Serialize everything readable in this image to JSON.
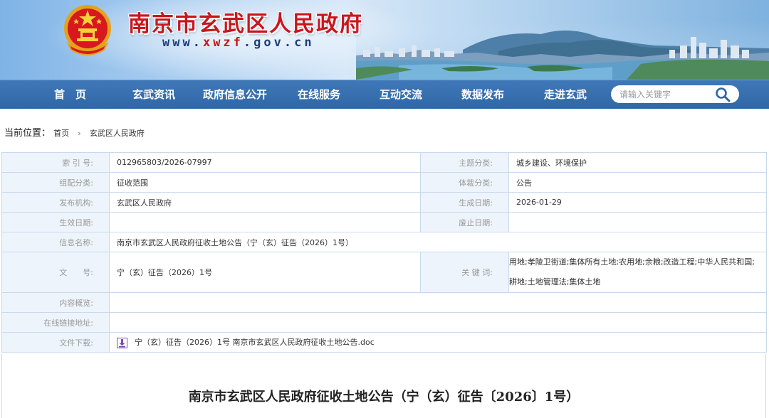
{
  "header": {
    "site_title": "南京市玄武区人民政府",
    "site_url_prefix": "www.",
    "site_url_highlight": "xwzf",
    "site_url_suffix": ".gov.cn",
    "emblem_icon": "national-emblem-icon",
    "brand_red": "#c8171e",
    "brand_blue": "#2f66a6"
  },
  "nav": {
    "items": [
      {
        "label": "首　页"
      },
      {
        "label": "玄武资讯"
      },
      {
        "label": "政府信息公开"
      },
      {
        "label": "在线服务"
      },
      {
        "label": "互动交流"
      },
      {
        "label": "数据发布"
      },
      {
        "label": "走进玄武"
      }
    ],
    "search_placeholder": "请输入关键字",
    "search_icon": "search-icon"
  },
  "breadcrumb": {
    "label": "当前位置：",
    "items": [
      "首页",
      "玄武区人民政府"
    ],
    "separator": "›"
  },
  "info": {
    "index_label": "索 引 号:",
    "index_value": "012965803/2026-07997",
    "topic_label": "主题分类:",
    "topic_value": "城乡建设、环境保护",
    "group_label": "组配分类:",
    "group_value": "征收范围",
    "genre_label": "体裁分类:",
    "genre_value": "公告",
    "publisher_label": "发布机构:",
    "publisher_value": "玄武区人民政府",
    "created_label": "生成日期:",
    "created_value": "2026-01-29",
    "effective_label": "生效日期:",
    "effective_value": "",
    "repeal_label": "废止日期:",
    "repeal_value": "",
    "name_label": "信息名称:",
    "name_value": "南京市玄武区人民政府征收土地公告（宁（玄）征告（2026）1号）",
    "docno_label": "文　　号:",
    "docno_value": "宁（玄）征告（2026）1号",
    "keywords_label": "关 键 词:",
    "keywords_value": "用地;孝陵卫街道;集体所有土地;农用地;余粮;改造工程;中华人民共和国;耕地;土地管理法;集体土地",
    "summary_label": "内容概览:",
    "summary_value": "",
    "link_label": "在线链接地址:",
    "link_value": "",
    "download_label": "文件下载:",
    "download_value": "宁（玄）征告（2026）1号 南京市玄武区人民政府征收土地公告.doc",
    "download_icon": "download-icon"
  },
  "document": {
    "title": "南京市玄武区人民政府征收土地公告（宁（玄）征告〔2026〕1号）"
  }
}
